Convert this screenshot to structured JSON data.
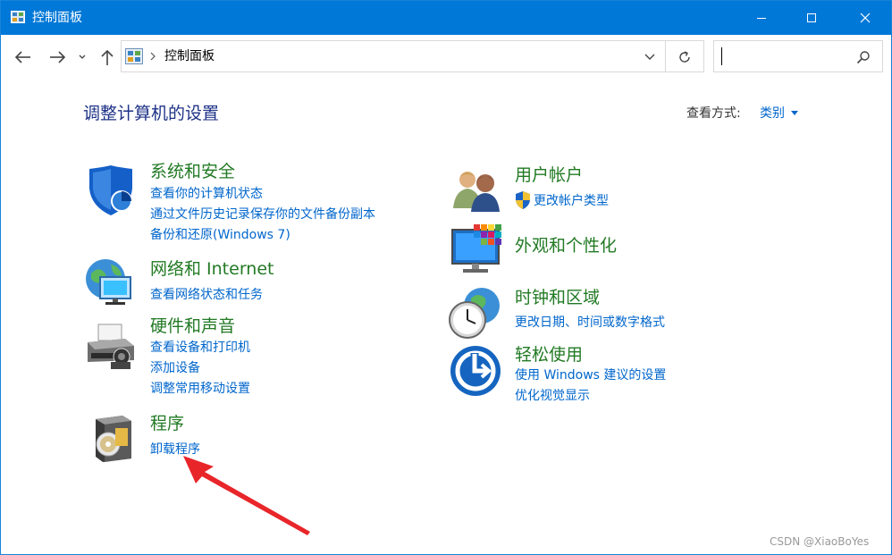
{
  "window": {
    "title": "控制面板",
    "accent": "#0078d7",
    "controls": [
      "minimize",
      "maximize",
      "close"
    ]
  },
  "address": {
    "path": "控制面板",
    "search_placeholder": ""
  },
  "main": {
    "heading": "调整计算机的设置",
    "view_by_label": "查看方式:",
    "view_by_value": "类别"
  },
  "left_categories": [
    {
      "title": "系统和安全",
      "icon": "shield-icon",
      "links": [
        "查看你的计算机状态",
        "通过文件历史记录保存你的文件备份副本",
        "备份和还原(Windows 7)"
      ]
    },
    {
      "title": "网络和 Internet",
      "icon": "network-globe-icon",
      "links": [
        "查看网络状态和任务"
      ]
    },
    {
      "title": "硬件和声音",
      "icon": "printer-icon",
      "links": [
        "查看设备和打印机",
        "添加设备",
        "调整常用移动设置"
      ]
    },
    {
      "title": "程序",
      "icon": "program-disc-icon",
      "links": [
        "卸载程序"
      ]
    }
  ],
  "right_categories": [
    {
      "title": "用户帐户",
      "icon": "users-icon",
      "links": [
        "更改帐户类型"
      ]
    },
    {
      "title": "外观和个性化",
      "icon": "monitor-color-icon",
      "links": []
    },
    {
      "title": "时钟和区域",
      "icon": "clock-globe-icon",
      "links": [
        "更改日期、时间或数字格式"
      ]
    },
    {
      "title": "轻松使用",
      "icon": "ease-of-access-icon",
      "links": [
        "使用 Windows 建议的设置",
        "优化视觉显示"
      ]
    }
  ],
  "colors": {
    "heading": "#1e3287",
    "category_title": "#227a24",
    "link": "#0066cc",
    "annotation_arrow": "#e8262a"
  },
  "watermark": "CSDN @XiaoBoYes"
}
